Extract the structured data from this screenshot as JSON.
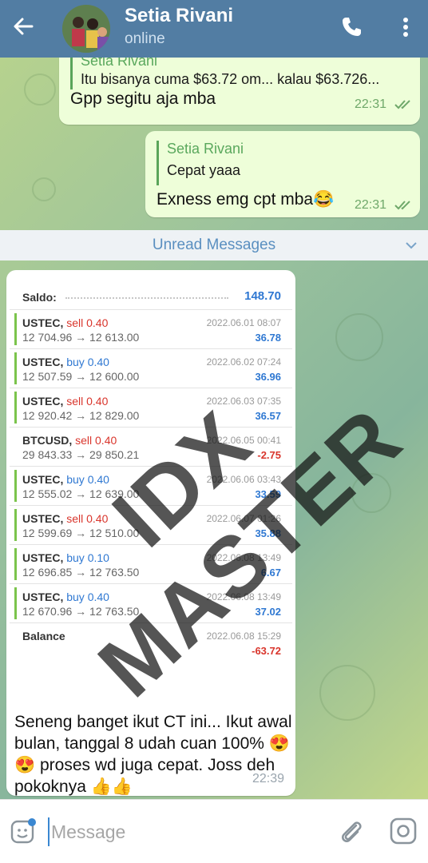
{
  "header": {
    "title": "Setia Rivani",
    "status": "online"
  },
  "messages": {
    "m1": {
      "quote_name": "Setia Rivani",
      "quote_text": "Itu bisanya cuma $63.72 om... kalau $63.726...",
      "text": "Gpp segitu aja mba",
      "time": "22:31"
    },
    "m2": {
      "quote_name": "Setia Rivani",
      "quote_text": "Cepat yaaa",
      "text": "Exness emg cpt mba😂",
      "time": "22:31"
    }
  },
  "unread": {
    "label": "Unread Messages"
  },
  "trade_shot": {
    "saldo_label": "Saldo:",
    "saldo_value": "148.70",
    "rows": [
      {
        "symbol": "USTEC,",
        "side": "sell 0.40",
        "side_type": "sell",
        "prices": "12 704.96 → 12 613.00",
        "datetime": "2022.06.01 08:07",
        "pl": "36.78",
        "pl_type": "pos"
      },
      {
        "symbol": "USTEC,",
        "side": "buy 0.40",
        "side_type": "buy",
        "prices": "12 507.59 → 12 600.00",
        "datetime": "2022.06.02 07:24",
        "pl": "36.96",
        "pl_type": "pos"
      },
      {
        "symbol": "USTEC,",
        "side": "sell 0.40",
        "side_type": "sell",
        "prices": "12 920.42 → 12 829.00",
        "datetime": "2022.06.03 07:35",
        "pl": "36.57",
        "pl_type": "pos"
      },
      {
        "symbol": "BTCUSD,",
        "side": "sell 0.40",
        "side_type": "sell",
        "prices": "29 843.33 → 29 850.21",
        "datetime": "2022.06.05 00:41",
        "pl": "-2.75",
        "pl_type": "neg"
      },
      {
        "symbol": "USTEC,",
        "side": "buy 0.40",
        "side_type": "buy",
        "prices": "12 555.02 → 12 639.00",
        "datetime": "2022.06.06 03:43",
        "pl": "33.59",
        "pl_type": "pos"
      },
      {
        "symbol": "USTEC,",
        "side": "sell 0.40",
        "side_type": "sell",
        "prices": "12 599.69 → 12 510.00",
        "datetime": "2022.06.07 01:26",
        "pl": "35.88",
        "pl_type": "pos"
      },
      {
        "symbol": "USTEC,",
        "side": "buy 0.10",
        "side_type": "buy",
        "prices": "12 696.85 → 12 763.50",
        "datetime": "2022.06.08 13:49",
        "pl": "6.67",
        "pl_type": "pos"
      },
      {
        "symbol": "USTEC,",
        "side": "buy 0.40",
        "side_type": "buy",
        "prices": "12 670.96 → 12 763.50",
        "datetime": "2022.06.08 13:49",
        "pl": "37.02",
        "pl_type": "pos"
      }
    ],
    "balance_label": "Balance",
    "balance_datetime": "2022.06.08 15:29",
    "balance_value": "-63.72"
  },
  "incoming": {
    "caption": "Seneng banget ikut CT ini... Ikut awal bulan, tanggal 8 udah cuan 100% 😍😍 proses wd juga cepat. Joss deh pokoknya 👍👍",
    "time": "22:39"
  },
  "watermark": "IDX MASTER",
  "composer": {
    "placeholder": "Message"
  },
  "colors": {
    "header": "#527da3",
    "outgoing_bubble": "#eefed9",
    "sell": "#d9352c",
    "buy": "#2f78d2",
    "accent": "#5aa85d"
  }
}
